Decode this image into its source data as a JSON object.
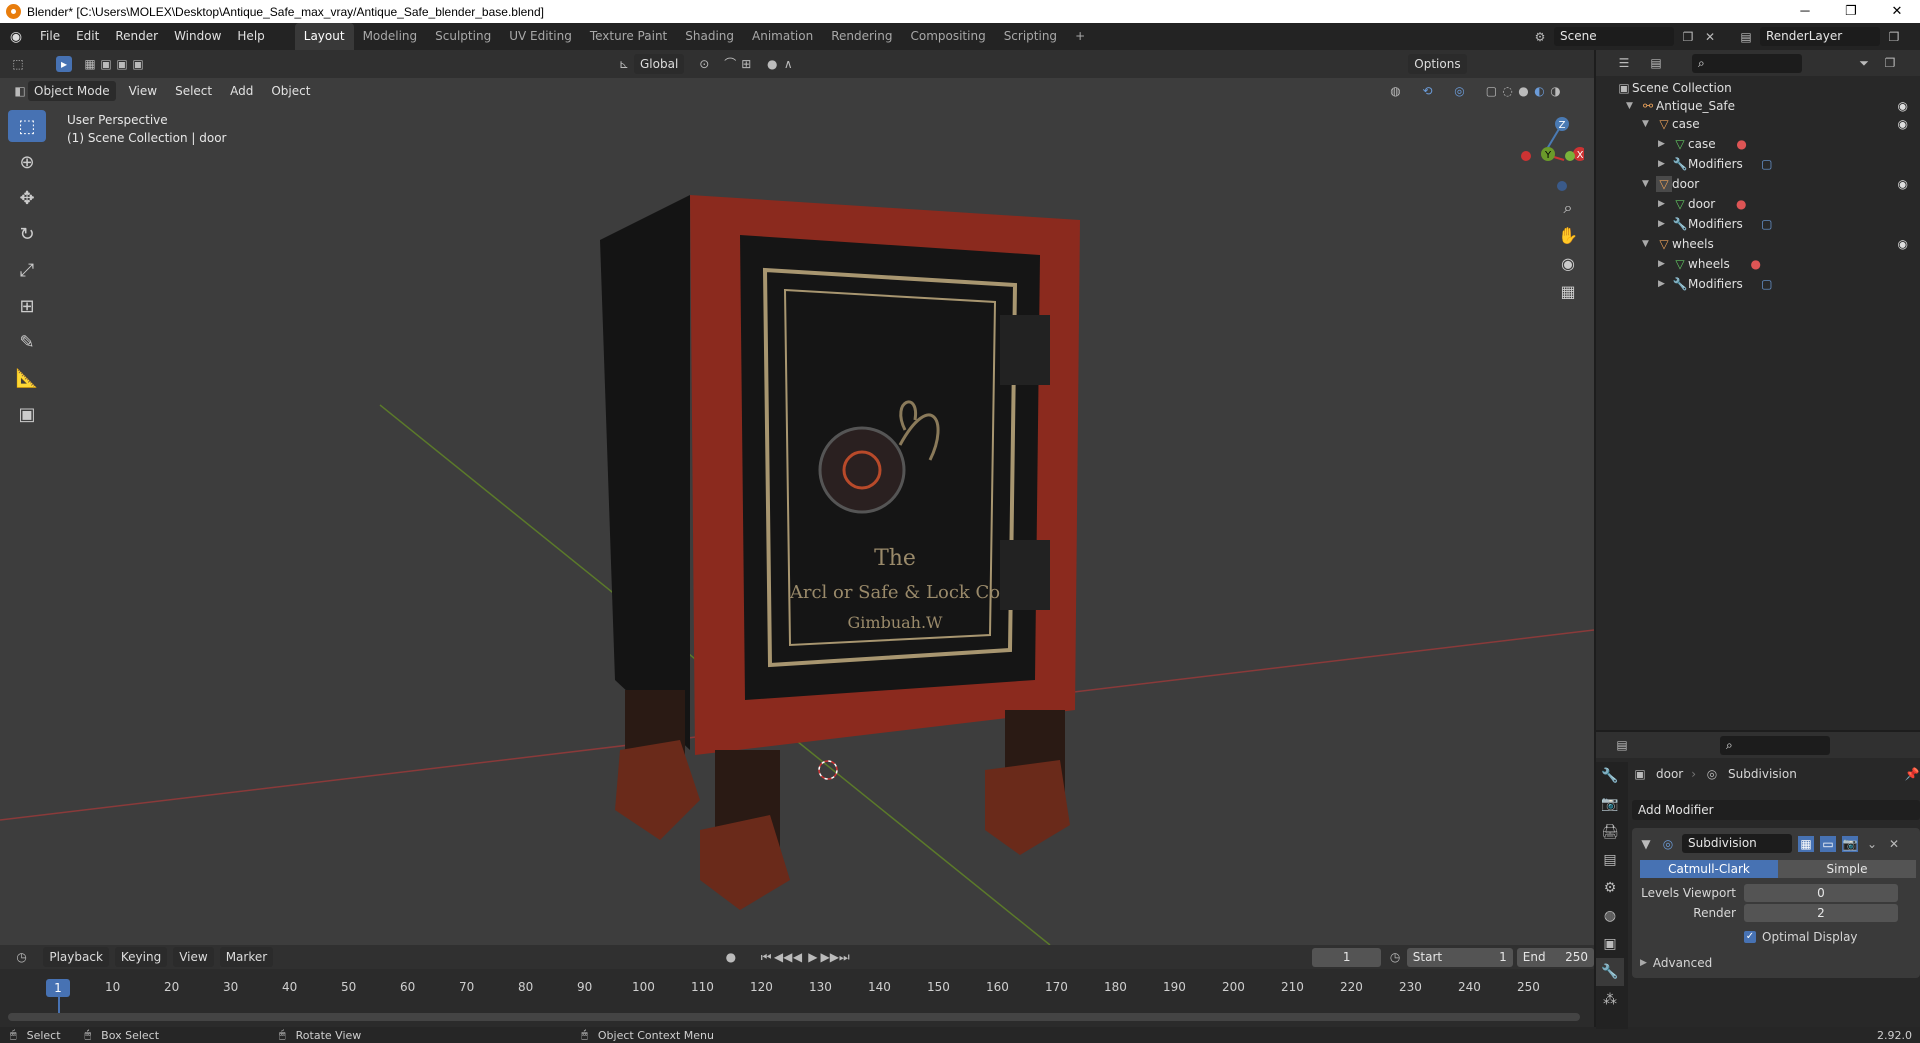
{
  "window": {
    "title": "Blender* [C:\\Users\\MOLEX\\Desktop\\Antique_Safe_max_vray/Antique_Safe_blender_base.blend]",
    "min": "─",
    "max": "❐",
    "close": "✕"
  },
  "topmenu": [
    "File",
    "Edit",
    "Render",
    "Window",
    "Help"
  ],
  "workspaces": [
    {
      "label": "Layout",
      "active": true
    },
    {
      "label": "Modeling"
    },
    {
      "label": "Sculpting"
    },
    {
      "label": "UV Editing"
    },
    {
      "label": "Texture Paint"
    },
    {
      "label": "Shading"
    },
    {
      "label": "Animation"
    },
    {
      "label": "Rendering"
    },
    {
      "label": "Compositing"
    },
    {
      "label": "Scripting"
    }
  ],
  "scene_name": "Scene",
  "render_layer": "RenderLayer",
  "viewport": {
    "transform_orientation": "Global",
    "options_label": "Options",
    "mode": "Object Mode",
    "menu": [
      "View",
      "Select",
      "Add",
      "Object"
    ],
    "info_line1": "User Perspective",
    "info_line2": "(1) Scene Collection | door",
    "gizmo_axis": {
      "z": "Z",
      "y": "Y",
      "x": "X"
    }
  },
  "model": {
    "engraving_line1": "The",
    "engraving_line2": "Arcl or Safe & Lock Co",
    "engraving_line3": "Gimbuah.W"
  },
  "outliner": {
    "root": "Scene Collection",
    "rows": [
      {
        "label": "Antique_Safe",
        "depth": 0
      },
      {
        "label": "case",
        "depth": 1
      },
      {
        "label": "case",
        "depth": 2
      },
      {
        "label": "Modifiers",
        "depth": 2
      },
      {
        "label": "door",
        "depth": 1
      },
      {
        "label": "door",
        "depth": 2
      },
      {
        "label": "Modifiers",
        "depth": 2
      },
      {
        "label": "wheels",
        "depth": 1
      },
      {
        "label": "wheels",
        "depth": 2
      },
      {
        "label": "Modifiers",
        "depth": 2
      }
    ]
  },
  "properties": {
    "object": "door",
    "modifier_crumb": "Subdivision",
    "add_modifier": "Add Modifier",
    "modifier_name": "Subdivision",
    "seg_catmull": "Catmull-Clark",
    "seg_simple": "Simple",
    "levels_viewport_label": "Levels Viewport",
    "levels_viewport_value": "0",
    "render_label": "Render",
    "render_value": "2",
    "optimal_display": "Optimal Display",
    "advanced": "Advanced"
  },
  "timeline": {
    "menu": [
      "Playback",
      "Keying",
      "View",
      "Marker"
    ],
    "current_frame": "1",
    "start_label": "Start",
    "start": "1",
    "end_label": "End",
    "end": "250",
    "ticks": [
      "1",
      "10",
      "20",
      "30",
      "40",
      "50",
      "60",
      "70",
      "80",
      "90",
      "100",
      "110",
      "120",
      "130",
      "140",
      "150",
      "160",
      "170",
      "180",
      "190",
      "200",
      "210",
      "220",
      "230",
      "240",
      "250"
    ]
  },
  "status": {
    "select": "Select",
    "box_select": "Box Select",
    "rotate": "Rotate View",
    "context": "Object Context Menu",
    "version": "2.92.0"
  },
  "colors": {
    "accent": "#4772b3",
    "viewport_bg": "#3d3d3d",
    "safe_red": "#8b2a1e"
  }
}
